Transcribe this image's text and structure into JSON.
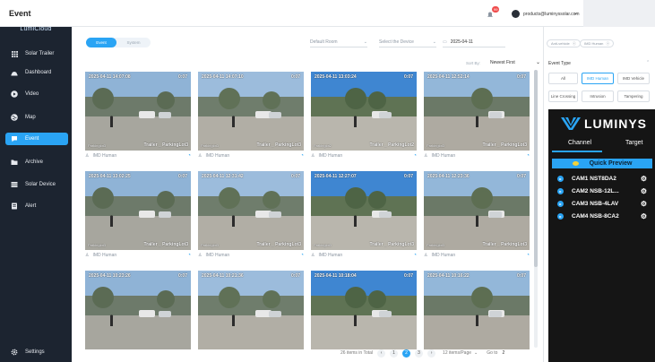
{
  "app": {
    "logo_text": "LumiCloud"
  },
  "sidebar": {
    "items": [
      {
        "label": "Solar Trailer",
        "icon": "grid-icon"
      },
      {
        "label": "Dashboard",
        "icon": "dashboard-icon"
      },
      {
        "label": "Video",
        "icon": "play-icon"
      },
      {
        "label": "Map",
        "icon": "globe-icon"
      },
      {
        "label": "Event",
        "icon": "event-icon",
        "active": true
      },
      {
        "label": "Archive",
        "icon": "folder-icon"
      },
      {
        "label": "Solar Device",
        "icon": "device-icon"
      },
      {
        "label": "Alert",
        "icon": "alert-icon"
      }
    ],
    "settings_label": "Settings"
  },
  "header": {
    "title": "Event",
    "notification_count": "99",
    "user_email": "products@luminyssolar.com"
  },
  "toolbar": {
    "tabs": [
      "Event",
      "System"
    ],
    "room_select": "Default Room",
    "device_select_placeholder": "Select the Device",
    "date": "2025-04-11",
    "sort_label": "Sort By:",
    "sort_value": "Newest First"
  },
  "events": [
    {
      "timestamp": "2025-04-11 14:07:08",
      "duration": "0:07",
      "location": "Trailer _ ParkingLot3",
      "camera": "Parkinglot3",
      "type": "IMD Human"
    },
    {
      "timestamp": "2025-04-11 14:07:10",
      "duration": "0:07",
      "location": "Trailer _ ParkingLot3",
      "camera": "Parkinglot3",
      "type": "IMD Human"
    },
    {
      "timestamp": "2025-04-11 13:03:24",
      "duration": "0:07",
      "location": "Trailer _ ParkingLot2",
      "camera": "Parkinglot2",
      "type": "IMD Human"
    },
    {
      "timestamp": "2025-04-11 12:52:14",
      "duration": "0:07",
      "location": "Trailer _ ParkingLot3",
      "camera": "Parkinglot3",
      "type": "IMD Human"
    },
    {
      "timestamp": "2025-04-11 13:02:25",
      "duration": "0:07",
      "location": "Trailer _ ParkingLot3",
      "camera": "Parkinglot3",
      "type": "IMD Human"
    },
    {
      "timestamp": "2025-04-11 12:31:42",
      "duration": "0:07",
      "location": "Trailer _ ParkingLot3",
      "camera": "Parkinglot3",
      "type": "IMD Human"
    },
    {
      "timestamp": "2025-04-11 12:27:07",
      "duration": "0:07",
      "location": "Trailer _ ParkingLot3",
      "camera": "Parkinglot3",
      "type": "IMD Human"
    },
    {
      "timestamp": "2025-04-11 12:23:36",
      "duration": "0:07",
      "location": "Trailer _ ParkingLot3",
      "camera": "Parkinglot3",
      "type": "IMD Human"
    },
    {
      "timestamp": "2025-04-11 10:23:26",
      "duration": "0:07",
      "location": "",
      "camera": "",
      "type": ""
    },
    {
      "timestamp": "2025-04-11 10:21:36",
      "duration": "0:07",
      "location": "",
      "camera": "",
      "type": ""
    },
    {
      "timestamp": "2025-04-11 10:18:04",
      "duration": "0:07",
      "location": "",
      "camera": "",
      "type": ""
    },
    {
      "timestamp": "2025-04-11 10:16:22",
      "duration": "0:07",
      "location": "",
      "camera": "",
      "type": ""
    }
  ],
  "pagination": {
    "total_text": "26 items in Total",
    "pages": [
      "1",
      "2",
      "3"
    ],
    "current_page": "2",
    "page_size": "12 items/Page",
    "goto_label": "Go to",
    "goto_value": "2"
  },
  "filters": {
    "chips": [
      "Anti-vehicle",
      "IMD Human"
    ],
    "event_type_label": "Event Type",
    "event_types": [
      "All",
      "IMD Human",
      "IMD Vehicle",
      "Line Crossing",
      "Intrusion",
      "Tampering"
    ],
    "selected_type": "IMD Human"
  },
  "widget": {
    "brand": "LUMINYS",
    "tabs": [
      "Channel",
      "Target"
    ],
    "quick_preview_label": "Quick Preview",
    "cameras": [
      "CAM1 NST8DA2",
      "CAM2 NSB-12L...",
      "CAM3 NSB-4LAV",
      "CAM4 NSB-8CA2"
    ]
  },
  "colors": {
    "accent": "#2aa4f4",
    "sidebar_bg": "#1c2430",
    "widget_bg": "#151515"
  }
}
